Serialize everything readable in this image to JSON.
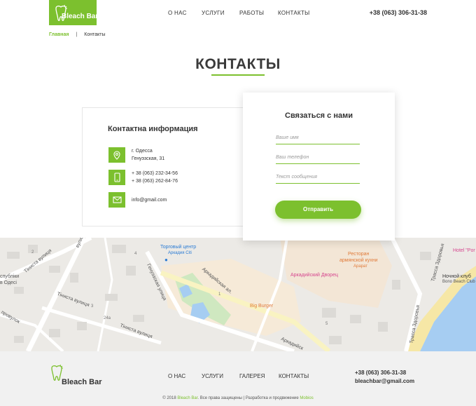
{
  "colors": {
    "accent": "#7cc02e"
  },
  "header": {
    "logo_text": "Bleach Bar",
    "nav": [
      "О НАС",
      "УСЛУГИ",
      "РАБОТЫ",
      "КОНТАКТЫ"
    ],
    "phone": "+38 (063) 306-31-38"
  },
  "breadcrumb": {
    "home": "Главная",
    "separator": "|",
    "current": "Контакты"
  },
  "page_title": "КОНТАКТЫ",
  "info": {
    "title": "Контактна информация",
    "address_line1": "г. Одесса",
    "address_line2": "Генуэзская, 31",
    "phone1": "+ 38 (063) 232-34-56",
    "phone2": "+ 38 (063) 262-84-76",
    "email": "info@gmail.com",
    "icons": [
      "location-pin-icon",
      "phone-icon",
      "envelope-icon"
    ]
  },
  "form": {
    "title": "Связаться с нами",
    "name_placeholder": "Ваше имя",
    "phone_placeholder": "Ваш телефон",
    "message_placeholder": "Текст сообщения",
    "submit_label": "Отправить"
  },
  "map": {
    "labels": {
      "shopping_center": "Торговый центр",
      "arcadia_city": "Аркадия Сiti",
      "restaurant_line1": "Ресторан",
      "restaurant_line2": "армянской кухни",
      "ararat": "Арарат",
      "arcadia_palace": "Аркадийский Дворец",
      "big_burger": "Big Burger",
      "night_club_line1": "Ночной клуб",
      "night_club_line2": "Bono Beach Club",
      "hotel": "Hotel \"Por",
      "arcadia_alley": "Аркадийская ал.",
      "arcadia_alley2": "Аркадийск",
      "genuezskaya": "Генуэзская улица",
      "tenista_1": "Тiниста вулиця",
      "tenista_2": "Тiниста вулиця",
      "tenista_3": "Тiниста вулиця",
      "vulitsa": "вулиц",
      "republic": "спублiки",
      "odesa": "в Одесi",
      "prokulok": "провулок",
      "trassa_1": "Трасса Здоровья",
      "trassa_2": "Трасса Здоровья",
      "house_24a": "24a",
      "house_1": "1",
      "house_2": "2",
      "house_3": "3",
      "house_4": "4",
      "house_5": "5"
    }
  },
  "footer": {
    "logo_text": "Bleach Bar",
    "nav": [
      "О НАС",
      "УСЛУГИ",
      "ГАЛЕРЕЯ",
      "КОНТАКТЫ"
    ],
    "phone": "+38 (063) 306-31-38",
    "email": "bleachbar@gmail.com",
    "copy_prefix": "© 2018",
    "copy_brand": "Bleach Bar",
    "copy_middle": ". Все права защищены | Разработка и продвижение",
    "copy_dev": "Mobios"
  }
}
